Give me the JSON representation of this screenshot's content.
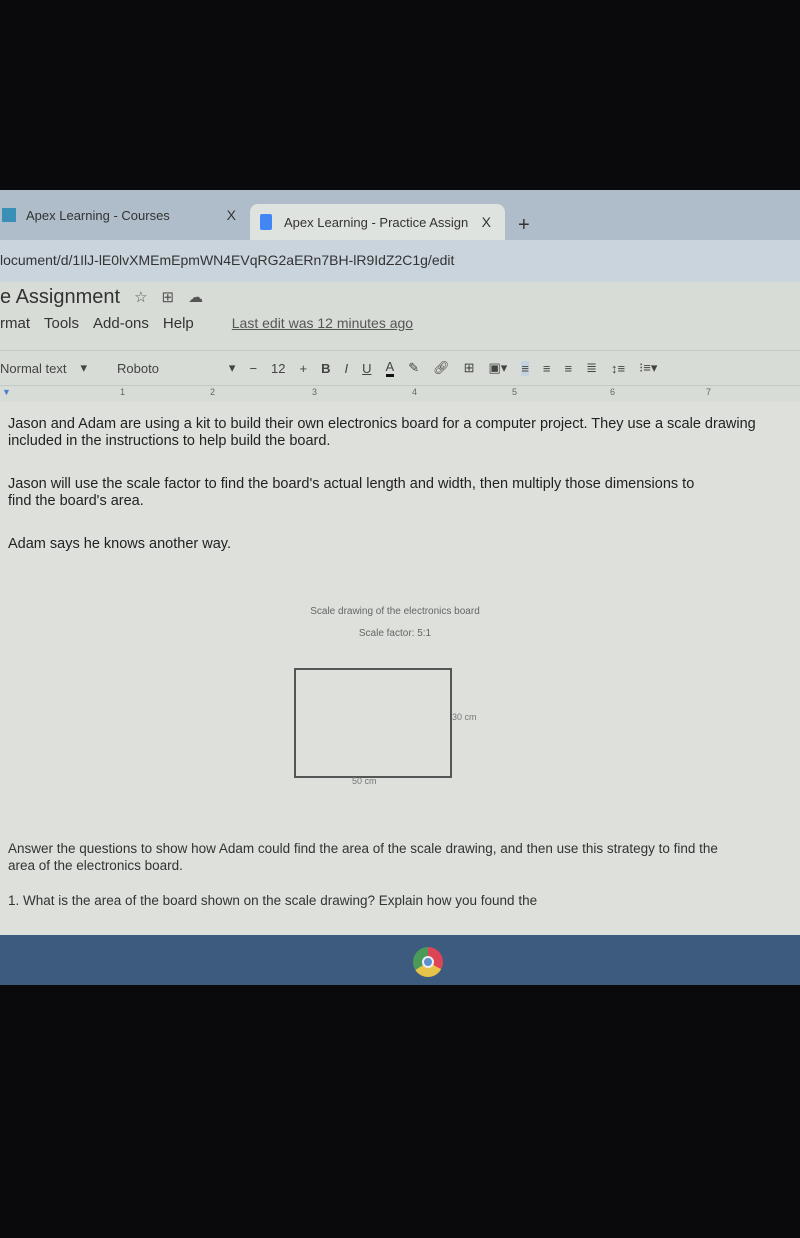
{
  "tabs": [
    {
      "label": "Apex Learning - Courses",
      "close": "X"
    },
    {
      "label": "Apex Learning - Practice Assign",
      "close": "X"
    }
  ],
  "new_tab": "+",
  "url": "locument/d/1IlJ-lE0lvXMEmEpmWN4EVqRG2aERn7BH-lR9IdZ2C1g/edit",
  "doc_title": "e Assignment",
  "menu": [
    "rmat",
    "Tools",
    "Add-ons",
    "Help"
  ],
  "last_edit": "Last edit was 12 minutes ago",
  "toolbar": {
    "style": "Normal text",
    "font": "Roboto",
    "minus": "−",
    "size": "12",
    "plus": "+",
    "bold": "B",
    "italic": "I",
    "underline": "U",
    "color": "A"
  },
  "ruler": [
    "1",
    "2",
    "3",
    "4",
    "5",
    "6",
    "7"
  ],
  "content": {
    "p1": "Jason and Adam are using a kit to build their own electronics board for a computer project. They use a scale drawing included in the instructions to help build the board.",
    "p2": "Jason will use the scale factor to find the board's actual length and width, then multiply those dimensions to find the board's area.",
    "p3": "Adam says he knows another way.",
    "figure_title": "Scale drawing of the electronics board",
    "scale_factor": "Scale factor: 5:1",
    "height_label": "30 cm",
    "width_label": "50 cm",
    "p4": "Answer the questions to show how Adam could find the area of the scale drawing, and then use this strategy to find the area of the electronics board.",
    "q1": "1. What is the area of the board shown on the scale drawing? Explain how you found the"
  }
}
